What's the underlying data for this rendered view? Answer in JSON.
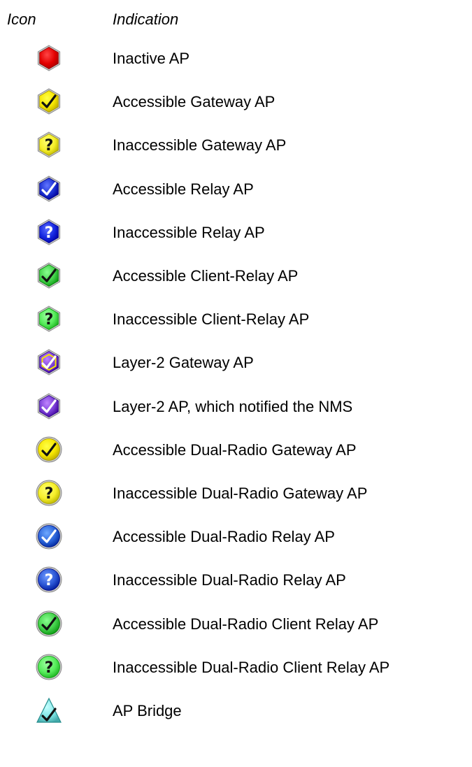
{
  "header": {
    "icon_label": "Icon",
    "indication_label": "Indication"
  },
  "rows": [
    {
      "label": "Inactive AP",
      "icon": "inactive-ap-icon",
      "color": "#e30000",
      "shape": "hex",
      "glyph": "none"
    },
    {
      "label": "Accessible Gateway AP",
      "icon": "accessible-gateway-ap-icon",
      "color": "#f6e500",
      "shape": "hex",
      "glyph": "check"
    },
    {
      "label": "Inaccessible Gateway AP",
      "icon": "inaccessible-gateway-ap-icon",
      "color": "#f6ef2a",
      "shape": "hex",
      "glyph": "question"
    },
    {
      "label": "Accessible Relay AP",
      "icon": "accessible-relay-ap-icon",
      "color": "#1b2fd1",
      "shape": "hex",
      "glyph": "check"
    },
    {
      "label": "Inaccessible Relay AP",
      "icon": "inaccessible-relay-ap-icon",
      "color": "#1527e0",
      "shape": "hex",
      "glyph": "question"
    },
    {
      "label": "Accessible Client-Relay AP",
      "icon": "accessible-client-relay-ap-icon",
      "color": "#43d14a",
      "shape": "hex",
      "glyph": "check"
    },
    {
      "label": "Inaccessible Client-Relay AP",
      "icon": "inaccessible-client-relay-ap-icon",
      "color": "#56ec5a",
      "shape": "hex",
      "glyph": "question"
    },
    {
      "label": "Layer-2 Gateway AP",
      "icon": "layer-2-gateway-ap-icon",
      "color": "#7a3ed6",
      "shape": "hex-ring",
      "glyph": "check"
    },
    {
      "label": "Layer-2 AP, which notified the NMS",
      "icon": "layer-2-ap-icon",
      "color": "#7a3ed6",
      "shape": "hex",
      "glyph": "check"
    },
    {
      "label": "Accessible Dual-Radio Gateway AP",
      "icon": "accessible-dual-radio-gateway-ap-icon",
      "color": "#f6e500",
      "shape": "circle",
      "glyph": "check"
    },
    {
      "label": "Inaccessible Dual-Radio Gateway AP",
      "icon": "inaccessible-dual-radio-gateway-ap-icon",
      "color": "#f6ef2a",
      "shape": "circle",
      "glyph": "question"
    },
    {
      "label": "Accessible Dual-Radio Relay AP",
      "icon": "accessible-dual-radio-relay-ap-icon",
      "color": "#2a63d8",
      "shape": "circle",
      "glyph": "check"
    },
    {
      "label": "Inaccessible Dual-Radio Relay AP",
      "icon": "inaccessible-dual-radio-relay-ap-icon",
      "color": "#2a55d4",
      "shape": "circle",
      "glyph": "question"
    },
    {
      "label": "Accessible Dual-Radio Client Relay AP",
      "icon": "accessible-dual-radio-client-relay-ap-icon",
      "color": "#43d14a",
      "shape": "circle",
      "glyph": "check"
    },
    {
      "label": "Inaccessible Dual-Radio Client Relay AP",
      "icon": "inaccessible-dual-radio-client-relay-ap-icon",
      "color": "#56ec5a",
      "shape": "circle",
      "glyph": "question"
    },
    {
      "label": "AP Bridge",
      "icon": "ap-bridge-icon",
      "color": "#7fe6e6",
      "shape": "triangle",
      "glyph": "check"
    }
  ]
}
